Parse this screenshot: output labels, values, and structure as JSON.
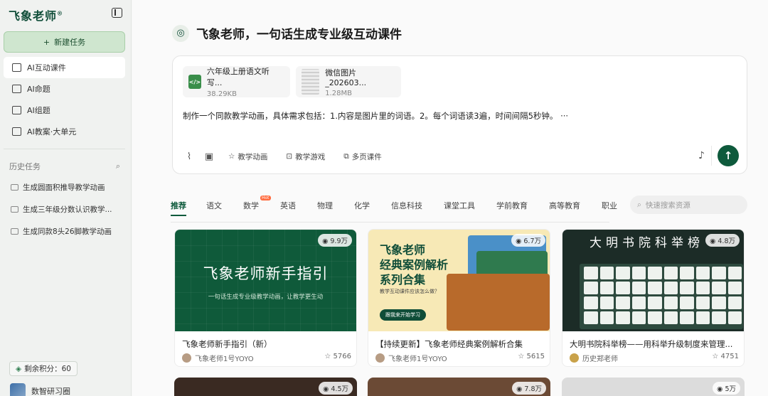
{
  "brand": {
    "logo": "飞象老师",
    "reg": "®"
  },
  "sidebar": {
    "new_task": "新建任务",
    "nav": [
      {
        "label": "AI互动课件",
        "active": true
      },
      {
        "label": "AI命题"
      },
      {
        "label": "AI组题"
      },
      {
        "label": "AI教案·大单元"
      }
    ],
    "history_title": "历史任务",
    "history": [
      "生成圆面积推导教学动画",
      "生成三年级分数认识教学...",
      "生成同款8头26脚教学动画"
    ],
    "credits": "剩余积分：60",
    "user": "数智研习圈"
  },
  "main": {
    "title": "飞象老师，一句话生成专业级互动课件",
    "files": [
      {
        "name": "六年级上册语文听写...",
        "size": "38.29KB"
      },
      {
        "name": "微信图片_202603...",
        "size": "1.28MB"
      }
    ],
    "prompt": "制作一个同款教学动画，具体需求包括：1.内容是图片里的词语。2。每个词语读3遍，时间间隔5秒钟。 ···",
    "chips": [
      "教学动画",
      "教学游戏",
      "多页课件"
    ],
    "tabs": [
      "推荐",
      "语文",
      "数学",
      "英语",
      "物理",
      "化学",
      "信息科技",
      "课堂工具",
      "学前教育",
      "高等教育",
      "职业"
    ],
    "hot_badge": "Hot",
    "search_placeholder": "快速搜索资源"
  },
  "cards": [
    {
      "views": "9.9万",
      "thumb_title": "飞象老师新手指引",
      "thumb_sub": "一句话生成专业级教学动画，让教学更生动",
      "title": "飞象老师新手指引（新）",
      "author": "飞象老师1号YOYO",
      "stars": "5766"
    },
    {
      "views": "6.7万",
      "thumb_title": "飞象老师\n经典案例解析\n系列合集",
      "thumb_sub": "教学互动课件应该怎么做？",
      "thumb_cta": "跟我来开始学习",
      "title": "【持续更新】飞象老师经典案例解析合集",
      "author": "飞象老师1号YOYO",
      "stars": "5615"
    },
    {
      "views": "4.8万",
      "thumb_title": "大明书院科举榜",
      "title": "大明书院科举榜——用科举升级制度来管理...",
      "author": "历史郑老师",
      "stars": "4751"
    }
  ],
  "bottom_cards": [
    {
      "views": "4.5万"
    },
    {
      "views": "7.8万"
    },
    {
      "views": "5万"
    }
  ],
  "colors": {
    "accent": "#0e5a3c",
    "hot": "#ff6a3d"
  }
}
